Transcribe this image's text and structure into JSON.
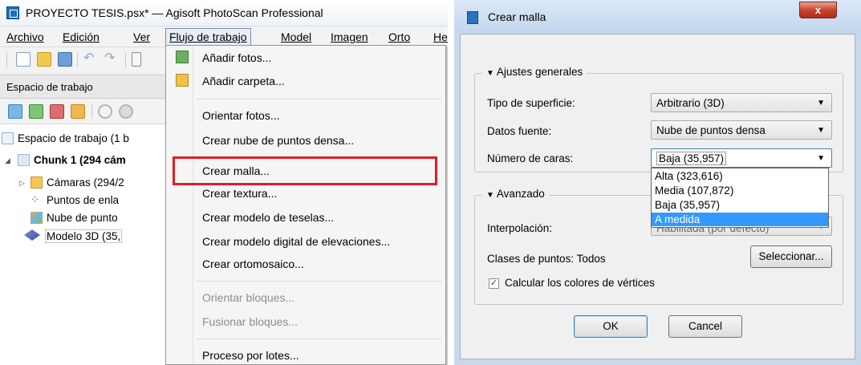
{
  "app": {
    "title": "PROYECTO TESIS.psx* — Agisoft PhotoScan Professional",
    "menubar": [
      "Archivo",
      "Edición",
      "Ver",
      "Flujo de trabajo",
      "Model",
      "Imagen",
      "Orto",
      "He"
    ],
    "workspace_label": "Espacio de trabajo",
    "tree": {
      "root": "Espacio de trabajo (1 b",
      "chunk": "Chunk 1 (294 cám",
      "items": [
        "Cámaras (294/2",
        "Puntos de enla",
        "Nube de punto",
        "Modelo 3D (35,"
      ]
    },
    "workflow_menu": {
      "items": [
        {
          "label": "Añadir fotos...",
          "enabled": true
        },
        {
          "label": "Añadir carpeta...",
          "enabled": true
        },
        {
          "label": "Orientar fotos...",
          "enabled": true
        },
        {
          "label": "Crear nube de puntos densa...",
          "enabled": true
        },
        {
          "label": "Crear malla...",
          "enabled": true,
          "highlighted": true
        },
        {
          "label": "Crear textura...",
          "enabled": true
        },
        {
          "label": "Crear modelo de teselas...",
          "enabled": true
        },
        {
          "label": "Crear modelo digital de elevaciones...",
          "enabled": true
        },
        {
          "label": "Crear ortomosaico...",
          "enabled": true
        },
        {
          "label": "Orientar bloques...",
          "enabled": false
        },
        {
          "label": "Fusionar bloques...",
          "enabled": false
        },
        {
          "label": "Proceso por lotes...",
          "enabled": true
        }
      ]
    }
  },
  "dialog": {
    "title": "Crear malla",
    "close_label": "x",
    "general": {
      "title": "Ajustes generales",
      "surface_label": "Tipo de superficie:",
      "surface_value": "Arbitrario (3D)",
      "source_label": "Datos fuente:",
      "source_value": "Nube de puntos densa",
      "faces_label": "Número de caras:",
      "faces_value": "Baja (35,957)",
      "faces_options": [
        "Alta (323,616)",
        "Media (107,872)",
        "Baja (35,957)",
        "A medida"
      ],
      "faces_hover_option": "A medida"
    },
    "advanced": {
      "title": "Avanzado",
      "interp_label": "Interpolación:",
      "interp_value_partial": "Habilitada (por defecto)",
      "classes_label": "Clases de puntos:",
      "classes_value": "Todos",
      "select_button": "Seleccionar...",
      "vertex_colors_label": "Calcular los colores de vértices",
      "vertex_colors_checked": true
    },
    "ok": "OK",
    "cancel": "Cancel"
  },
  "colors": {
    "highlight_border": "#e31b23",
    "selection": "#3399ff",
    "close_button": "#c8432c"
  }
}
